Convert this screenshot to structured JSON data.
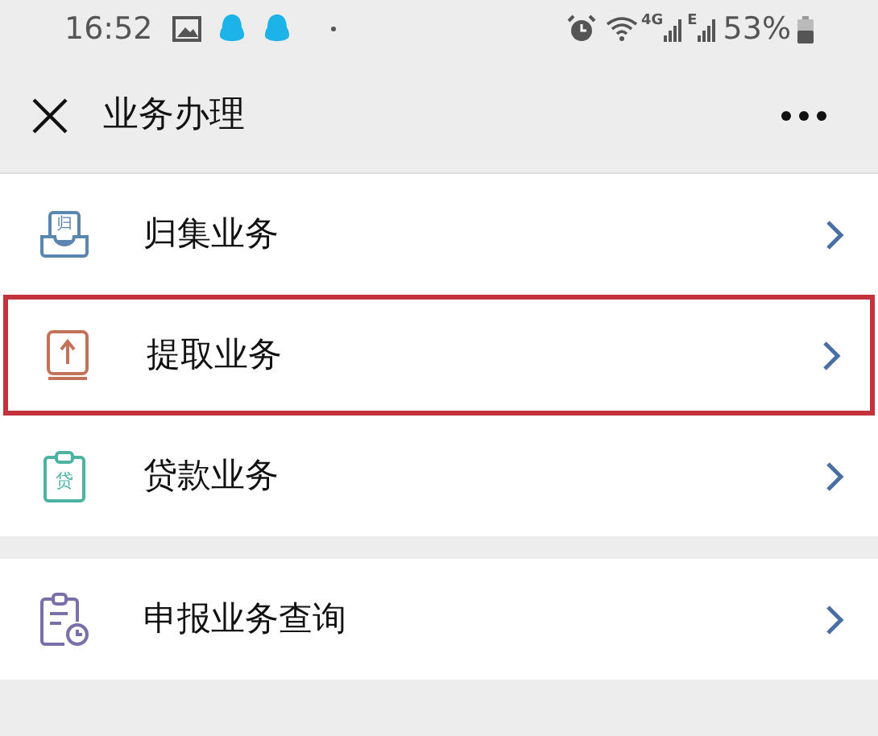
{
  "status_bar": {
    "time": "16:52",
    "network_labels": [
      "4G",
      "E"
    ],
    "battery": "53%"
  },
  "header": {
    "title": "业务办理"
  },
  "groups": [
    {
      "items": [
        {
          "kind": "inbox",
          "icon_text": "归",
          "label": "归集业务",
          "highlighted": false
        },
        {
          "kind": "upload",
          "label": "提取业务",
          "highlighted": true
        },
        {
          "kind": "clipboard",
          "icon_text": "贷",
          "label": "贷款业务",
          "highlighted": false
        }
      ]
    },
    {
      "items": [
        {
          "kind": "report",
          "label": "申报业务查询",
          "highlighted": false
        }
      ]
    }
  ]
}
